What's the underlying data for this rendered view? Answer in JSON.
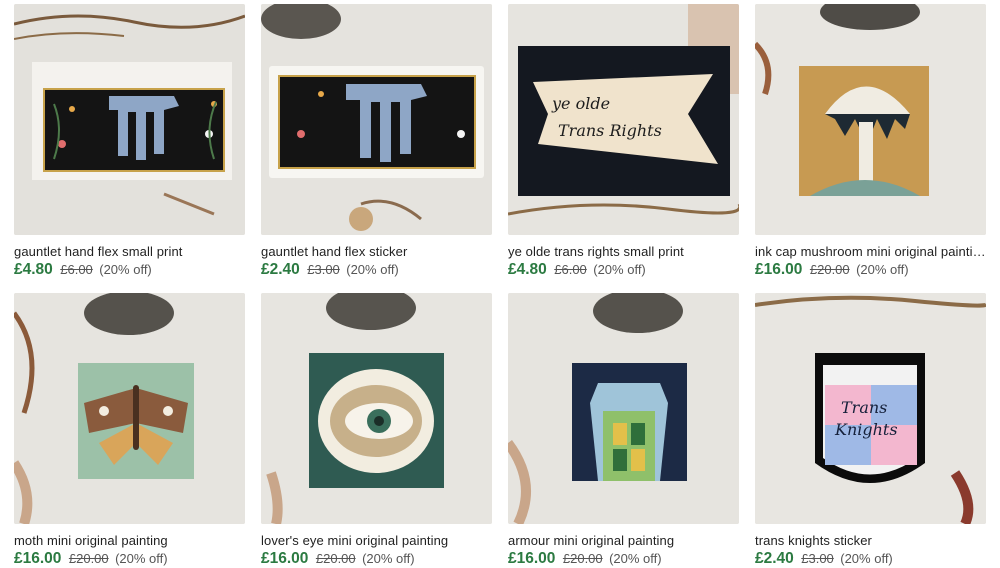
{
  "listings": [
    {
      "title": "gauntlet hand flex small print",
      "price": "£4.80",
      "original_price": "£6.00",
      "discount": "(20% off)"
    },
    {
      "title": "gauntlet hand flex sticker",
      "price": "£2.40",
      "original_price": "£3.00",
      "discount": "(20% off)"
    },
    {
      "title": "ye olde trans rights small print",
      "price": "£4.80",
      "original_price": "£6.00",
      "discount": "(20% off)",
      "artwork_text": "ye olde Trans Rights"
    },
    {
      "title": "ink cap mushroom mini original painting",
      "price": "£16.00",
      "original_price": "£20.00",
      "discount": "(20% off)"
    },
    {
      "title": "moth mini original painting",
      "price": "£16.00",
      "original_price": "£20.00",
      "discount": "(20% off)"
    },
    {
      "title": "lover's eye mini original painting",
      "price": "£16.00",
      "original_price": "£20.00",
      "discount": "(20% off)"
    },
    {
      "title": "armour mini original painting",
      "price": "£16.00",
      "original_price": "£20.00",
      "discount": "(20% off)"
    },
    {
      "title": "trans knights sticker",
      "price": "£2.40",
      "original_price": "£3.00",
      "discount": "(20% off)",
      "artwork_text": "Trans Knights"
    }
  ],
  "colors": {
    "price_green": "#2b7a41",
    "text": "#222222",
    "muted": "#555555"
  }
}
